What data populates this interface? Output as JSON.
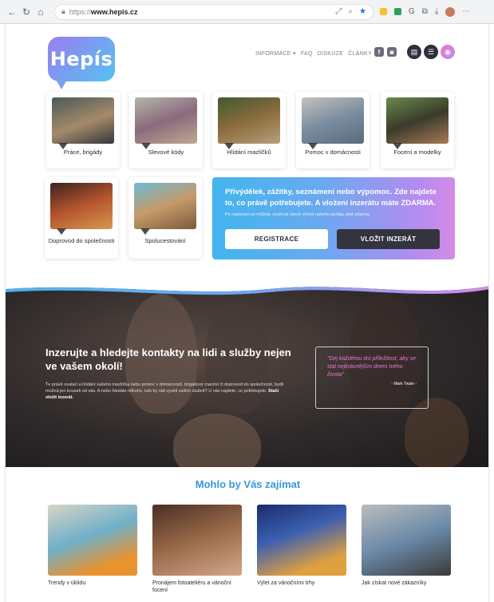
{
  "browser": {
    "url_protocol": "https://",
    "url_host": "www.hepis.cz",
    "icons": [
      "back-icon",
      "refresh-icon",
      "home-icon",
      "lock-icon",
      "star-icon",
      "extensions-icon"
    ]
  },
  "brand": {
    "logo_text": "Hepís",
    "accent": "#3498db",
    "dark": "#34343f"
  },
  "nav": {
    "items": [
      "INFORMACE ▾",
      "FAQ",
      "DISKUZE",
      "ČLÁNKY"
    ]
  },
  "header_icons": {
    "fb": "f",
    "ig": "◙"
  },
  "categories": [
    {
      "label": "Práce, brigády",
      "thumb": "linear-gradient(160deg,#4a5a58,#a58a6a 55%,#33383a)"
    },
    {
      "label": "Slevové kódy",
      "thumb": "linear-gradient(160deg,#b3b7a6,#8a6a7e 50%,#c0a890)"
    },
    {
      "label": "Hlídání mazlíčků",
      "thumb": "linear-gradient(160deg,#3f5a2f,#8b6c3e 50%,#b7a07a)"
    },
    {
      "label": "Pomoc v domácnosti",
      "thumb": "linear-gradient(160deg,#c4c2bc,#7a8da0 50%,#5b6b7a)"
    },
    {
      "label": "Focení a modelky",
      "thumb": "linear-gradient(160deg,#6a8a4a,#3b3b2b 50%,#a67a56)"
    },
    {
      "label": "Doprovod do společnosti",
      "thumb": "linear-gradient(160deg,#3a2420,#b5542e 50%,#d49a50)"
    },
    {
      "label": "Spolucestování",
      "thumb": "linear-gradient(160deg,#6cbad3,#c59a6a 50%,#7a5a3a)"
    }
  ],
  "promo": {
    "headline": "Přivýdělek, zážitky, seznámení nebo výpomoc. Zde najdete to, co právě potřebujete. A vložení inzerátu máte ZDARMA.",
    "sub": "Po registraci se můžete využívat všech výhod našeho portálu plně zdarma",
    "register_label": "REGISTRACE",
    "insert_label": "VLOŽIT INZERÁT"
  },
  "hero": {
    "title": "Inzerujte a hledejte kontakty na lidi a služby nejen ve vašem okolí!",
    "text": "Ťe právě ovatarí a hlídání vašeho mazlíčka nebo pomoc v domácnosti, brigádový manžel či doprovod do společnosti, bydlí možná jen kousek od vás. A nebo hledáte někoho, kdo by rád využil vašich služeb? U nás najdete, co potřebujete.",
    "text_bold": "Stačí vložit inzerát.",
    "quote": "\"Dej každému dni příležitost, aby se stal nejkrásnějším dnem tvého života\"",
    "quote_author": "- Mark Twain -"
  },
  "articles": {
    "section_title": "Mohlo by Vás zajímat",
    "items": [
      {
        "title": "Trendy v úklidu",
        "img": "linear-gradient(160deg,#d8d4c6,#6fb0c8 45%,#e8932e 80%)"
      },
      {
        "title": "Pronájem fotoateliéru a vánoční focení",
        "img": "linear-gradient(160deg,#4a2f22,#9a6a4a 50%,#d4a78a)"
      },
      {
        "title": "Výlet za vánočními trhy",
        "img": "linear-gradient(160deg,#1b2c6a,#3b5fb0 40%,#e0a040 80%)"
      },
      {
        "title": "Jak získat nové zákazníky",
        "img": "linear-gradient(160deg,#bcbcbc,#6b8aa8 50%,#3a3a3a)"
      }
    ]
  }
}
